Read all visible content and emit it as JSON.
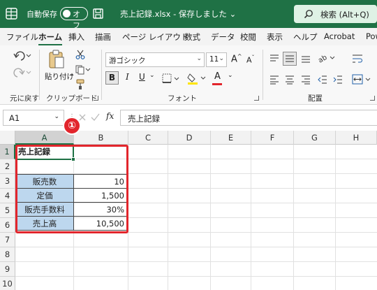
{
  "titlebar": {
    "autosave_label": "自動保存",
    "autosave_state": "オフ",
    "doc_title": "売上記録.xlsx - 保存しました ⌄",
    "search_placeholder": "検索 (Alt+Q)",
    "brand_color": "#1f7145"
  },
  "ribbon_tabs": [
    "ファイル",
    "ホーム",
    "挿入",
    "描画",
    "ページ レイアウト",
    "数式",
    "データ",
    "校閲",
    "表示",
    "ヘルプ",
    "Acrobat",
    "Pow"
  ],
  "active_tab": "ホーム",
  "ribbon": {
    "undo_group_label": "元に戻す",
    "paste_label": "貼り付け",
    "clipboard_group_label": "クリップボード",
    "font_name": "游ゴシック",
    "font_size": "11",
    "grow_font": "A",
    "shrink_font": "A",
    "bold": "B",
    "italic": "I",
    "underline": "U",
    "font_color_glyph": "A",
    "font_group_label": "フォント",
    "alignment_group_label": "配置"
  },
  "formula_bar": {
    "name_box": "A1",
    "fx": "fx",
    "content": "売上記録"
  },
  "columns": [
    "A",
    "B",
    "C",
    "D",
    "E",
    "F",
    "G",
    "H"
  ],
  "rows": [
    "1",
    "2",
    "3",
    "4",
    "5",
    "6",
    "7",
    "8",
    "9",
    "10"
  ],
  "cells": {
    "A1": "売上記録",
    "A3": "販売数",
    "B3": "10",
    "A4": "定価",
    "B4": "1,500",
    "A5": "販売手数料",
    "B5": "30%",
    "A6": "売上高",
    "B6": "10,500"
  },
  "annotation": {
    "step_badge": "①",
    "highlight_color": "#e2252c",
    "label_fill_color": "#bdd7ee"
  }
}
